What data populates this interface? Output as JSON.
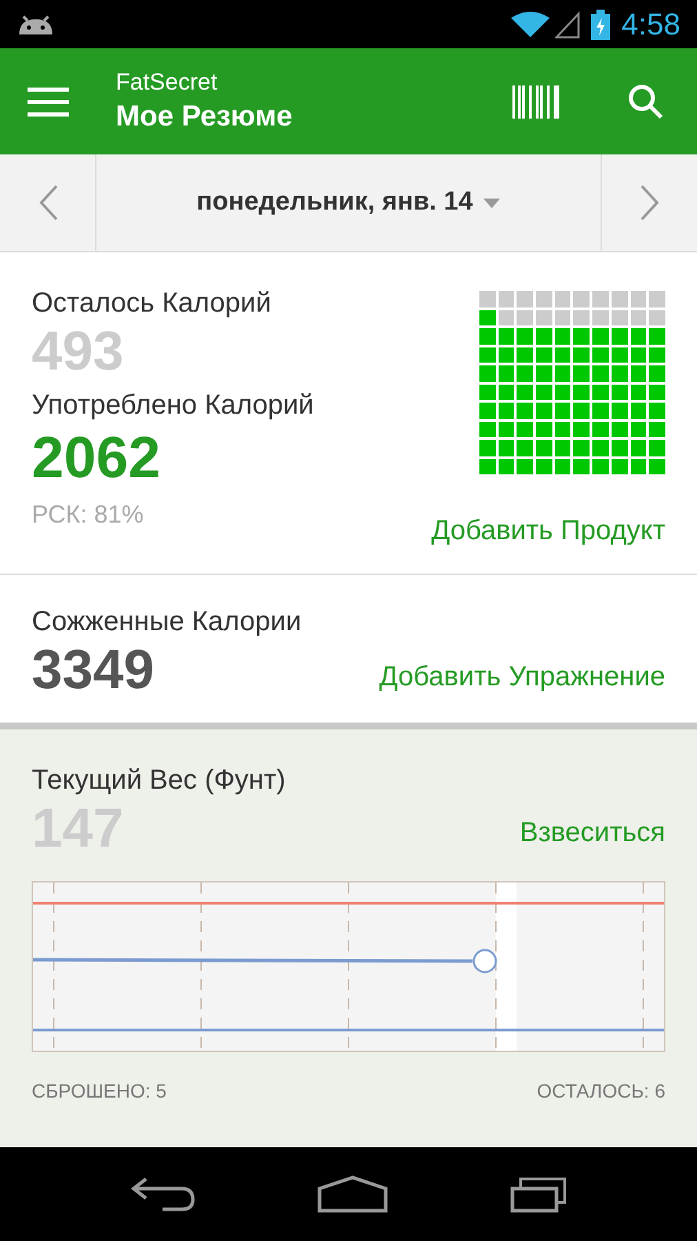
{
  "status_bar": {
    "time": "4:58",
    "battery_charging": true
  },
  "app_bar": {
    "app_name": "FatSecret",
    "title": "Мое Резюме"
  },
  "date_bar": {
    "date": "понедельник, янв. 14"
  },
  "calories": {
    "remaining_label": "Осталось Калорий",
    "remaining": "493",
    "consumed_label": "Употреблено Калорий",
    "consumed": "2062",
    "rdi": "РСК: 81%",
    "add_food": "Добавить Продукт"
  },
  "burned": {
    "label": "Сожженные Калории",
    "value": "3349",
    "add_exercise": "Добавить Упражнение"
  },
  "weight": {
    "label": "Текущий Вес (Фунт)",
    "value": "147",
    "weigh_in": "Взвеситься",
    "lost": "СБРОШЕНО: 5",
    "remaining": "ОСТАЛОСЬ: 6"
  }
}
